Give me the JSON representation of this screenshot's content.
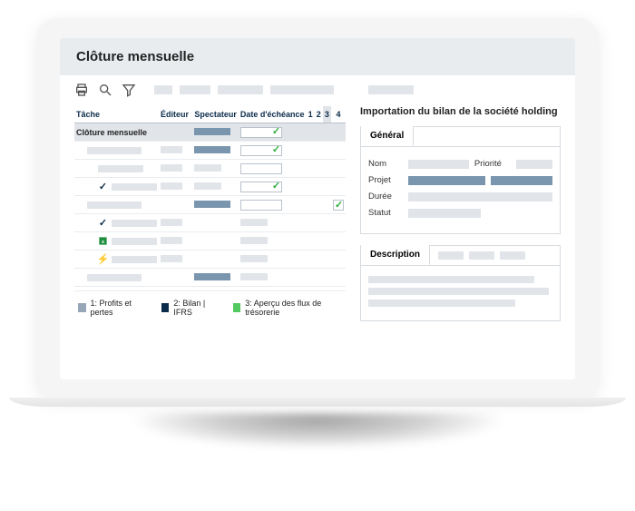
{
  "header": {
    "title": "Clôture mensuelle"
  },
  "table": {
    "headers": {
      "task": "Tâche",
      "editor": "Éditeur",
      "viewer": "Spectateur",
      "due": "Date d'échéance",
      "c1": "1",
      "c2": "2",
      "c3": "3",
      "c4": "4"
    },
    "group_label": "Clôture mensuelle"
  },
  "legend": {
    "l1": "1: Profits et pertes",
    "l2": "2: Bilan | IFRS",
    "l3": "3: Aperçu des flux de trésorerie",
    "colors": {
      "l1": "#97a7b8",
      "l2": "#0b2b4a",
      "l3": "#51c960"
    }
  },
  "side": {
    "title": "Importation du bilan de la société holding",
    "tab_general": "Général",
    "tab_description": "Description",
    "fields": {
      "name": "Nom",
      "priority": "Priorité",
      "project": "Projet",
      "duration": "Durée",
      "status": "Statut"
    }
  },
  "icons": {
    "print": "print-icon",
    "search": "search-icon",
    "filter": "filter-icon",
    "excel": "excel-icon",
    "bolt": "bolt-icon",
    "check": "check-icon"
  }
}
